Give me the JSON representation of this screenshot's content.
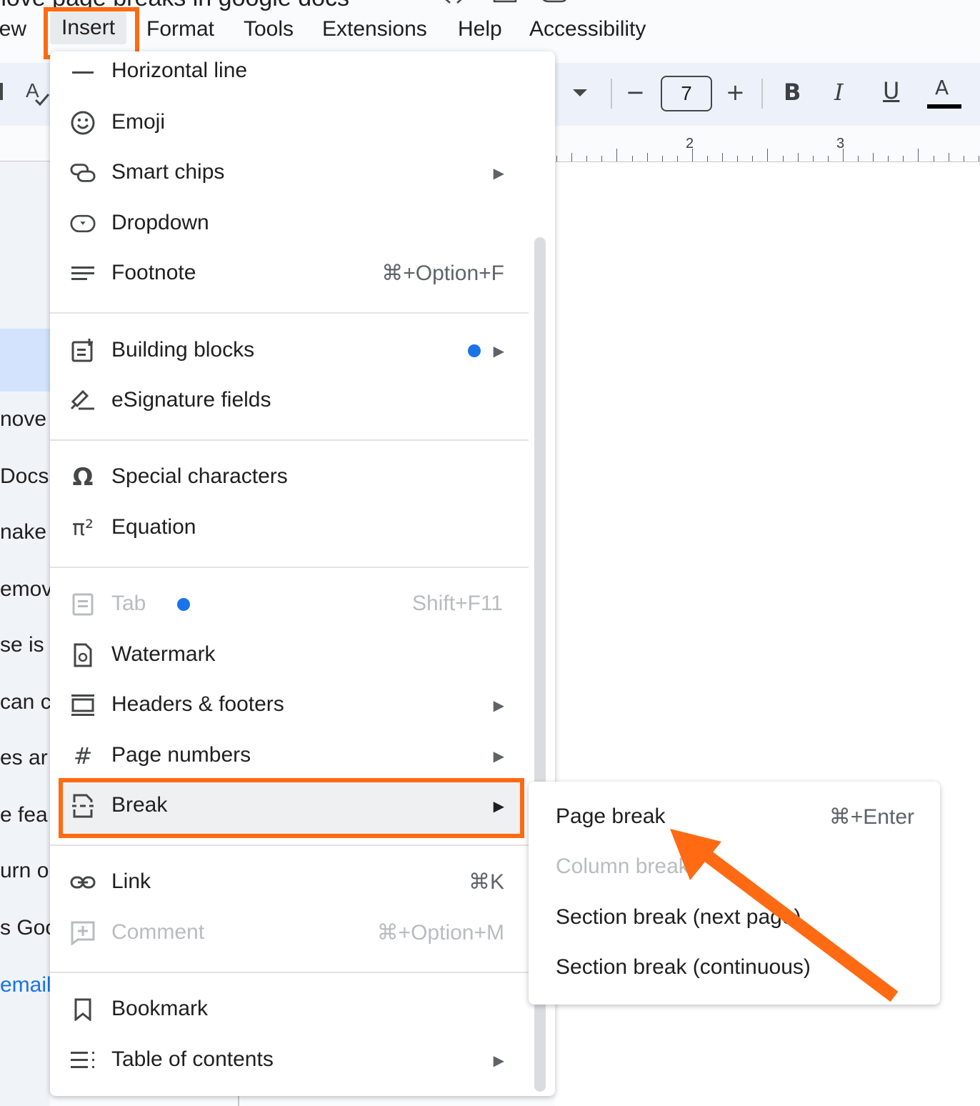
{
  "document_title": "nove page breaks in google docs",
  "menubar": {
    "items": [
      "iew",
      "Insert",
      "Format",
      "Tools",
      "Extensions",
      "Help",
      "Accessibility"
    ]
  },
  "toolbar": {
    "font_size": "7",
    "decrease_label": "−",
    "increase_label": "+",
    "bold_label": "B",
    "italic_label": "I",
    "underline_label": "U",
    "text_color_label": "A"
  },
  "ruler": {
    "numbers": [
      "2",
      "3"
    ]
  },
  "doc_left_snippets": [
    "nove",
    "Docs",
    "nake",
    "emov",
    "se is c",
    "can c",
    "es ar",
    "e fea",
    "urn o",
    "s Goo",
    "emails"
  ],
  "insert_menu": {
    "items": [
      {
        "label": "Horizontal line",
        "icon": "horizontal-line-icon"
      },
      {
        "label": "Emoji",
        "icon": "emoji-icon"
      },
      {
        "label": "Smart chips",
        "icon": "smart-chips-icon",
        "submenu": true
      },
      {
        "label": "Dropdown",
        "icon": "dropdown-icon"
      },
      {
        "label": "Footnote",
        "icon": "footnote-icon",
        "shortcut": "⌘+Option+F"
      },
      {
        "label": "Building blocks",
        "icon": "building-blocks-icon",
        "submenu": true,
        "new_dot": true
      },
      {
        "label": "eSignature fields",
        "icon": "esignature-icon"
      },
      {
        "label": "Special characters",
        "icon": "omega-icon"
      },
      {
        "label": "Equation",
        "icon": "pi-icon"
      },
      {
        "label": "Tab",
        "icon": "tab-icon",
        "shortcut": "Shift+F11",
        "disabled": true,
        "new_dot": true
      },
      {
        "label": "Watermark",
        "icon": "watermark-icon"
      },
      {
        "label": "Headers & footers",
        "icon": "headers-footers-icon",
        "submenu": true
      },
      {
        "label": "Page numbers",
        "icon": "hash-icon",
        "submenu": true
      },
      {
        "label": "Break",
        "icon": "break-icon",
        "submenu": true,
        "active": true
      },
      {
        "label": "Link",
        "icon": "link-icon",
        "shortcut": "⌘K"
      },
      {
        "label": "Comment",
        "icon": "comment-icon",
        "shortcut": "⌘+Option+M",
        "disabled": true
      },
      {
        "label": "Bookmark",
        "icon": "bookmark-icon"
      },
      {
        "label": "Table of contents",
        "icon": "toc-icon",
        "submenu": true
      }
    ],
    "submenu_arrow": "▶"
  },
  "break_submenu": {
    "items": [
      {
        "label": "Page break",
        "shortcut": "⌘+Enter"
      },
      {
        "label": "Column break",
        "disabled": true
      },
      {
        "label": "Section break (next page)"
      },
      {
        "label": "Section break (continuous)"
      }
    ]
  },
  "colors": {
    "highlight_orange": "#ff6a13",
    "new_dot_blue": "#1a73e8",
    "selection_blue": "#d3e3fd"
  }
}
